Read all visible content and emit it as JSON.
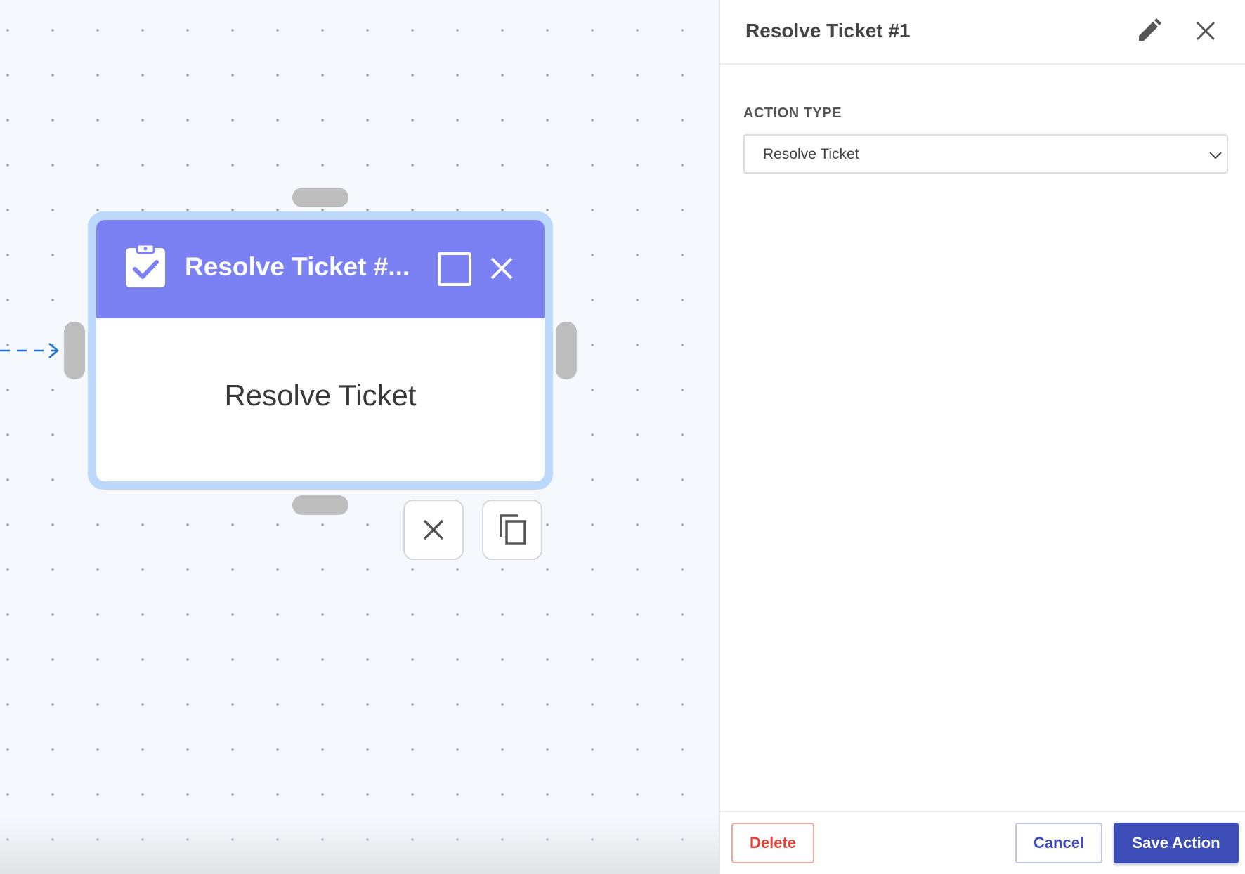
{
  "canvas": {
    "node": {
      "title": "Resolve Ticket #...",
      "body_text": "Resolve Ticket",
      "header_color": "#7b80f3",
      "icon": "clipboard-check-icon"
    },
    "node_tools": {
      "delete_icon": "close-icon",
      "copy_icon": "copy-icon"
    }
  },
  "panel": {
    "title": "Resolve Ticket #1",
    "field_label": "ACTION TYPE",
    "action_type": {
      "selected": "Resolve Ticket"
    },
    "buttons": {
      "delete": "Delete",
      "cancel": "Cancel",
      "save": "Save Action"
    },
    "colors": {
      "primary": "#3d4db8",
      "danger": "#e04336"
    }
  }
}
